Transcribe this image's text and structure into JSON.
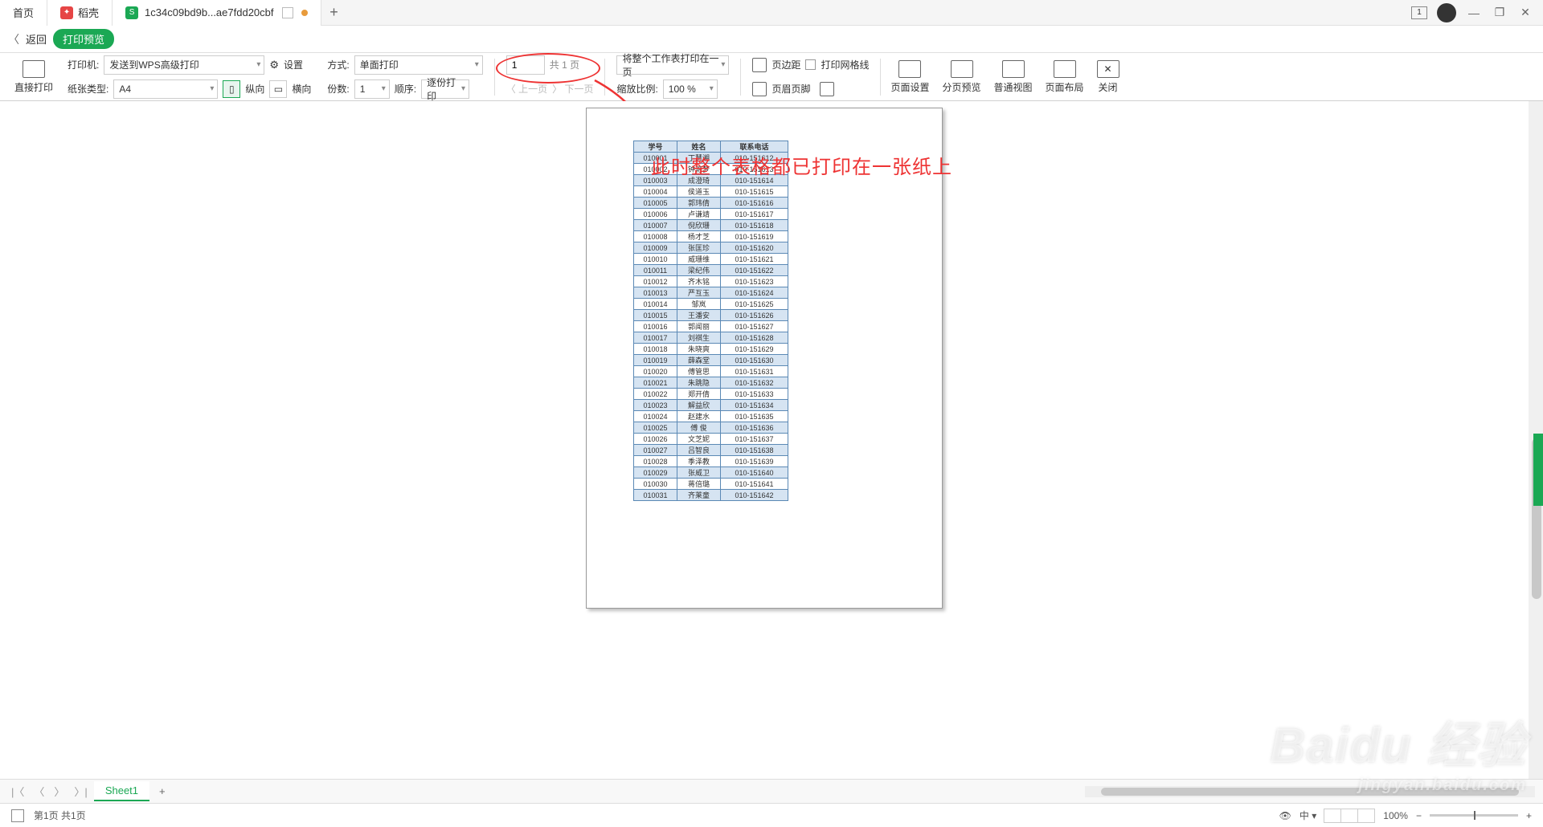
{
  "tabs": {
    "home": "首页",
    "doc": "稻壳",
    "file": "1c34c09bd9b...ae7fdd20cbf",
    "badge": "1"
  },
  "header": {
    "back": "返回",
    "title": "打印预览"
  },
  "toolbar": {
    "direct_print": "直接打印",
    "printer_label": "打印机:",
    "printer_value": "发送到WPS高级打印",
    "paper_label": "纸张类型:",
    "paper_value": "A4",
    "settings": "设置",
    "portrait": "纵向",
    "landscape": "横向",
    "mode_label": "方式:",
    "mode_value": "单面打印",
    "copies_label": "份数:",
    "copies_value": "1",
    "order_label": "顺序:",
    "order_value": "逐份打印",
    "page_current": "1",
    "page_total": "共 1 页",
    "prev_page": "上一页",
    "next_page": "下一页",
    "fit_value": "将整个工作表打印在一页",
    "zoom_label": "缩放比例:",
    "zoom_value": "100 %",
    "margins": "页边距",
    "header_footer": "页眉页脚",
    "print_grid": "打印网格线",
    "page_setup": "页面设置",
    "page_break": "分页预览",
    "normal_view": "普通视图",
    "page_layout": "页面布局",
    "close": "关闭"
  },
  "table": {
    "headers": [
      "学号",
      "姓名",
      "联系电话"
    ],
    "rows": [
      [
        "010001",
        "丁慧湘",
        "010-151612"
      ],
      [
        "010002",
        "钟艳梦",
        "010-151613"
      ],
      [
        "010003",
        "成澄琦",
        "010-151614"
      ],
      [
        "010004",
        "侯道玉",
        "010-151615"
      ],
      [
        "010005",
        "郭玮倩",
        "010-151616"
      ],
      [
        "010006",
        "卢谦靖",
        "010-151617"
      ],
      [
        "010007",
        "倪欣珊",
        "010-151618"
      ],
      [
        "010008",
        "杨才芝",
        "010-151619"
      ],
      [
        "010009",
        "张匡珍",
        "010-151620"
      ],
      [
        "010010",
        "威珊维",
        "010-151621"
      ],
      [
        "010011",
        "梁纪伟",
        "010-151622"
      ],
      [
        "010012",
        "齐木铭",
        "010-151623"
      ],
      [
        "010013",
        "严互玉",
        "010-151624"
      ],
      [
        "010014",
        "邹岚",
        "010-151625"
      ],
      [
        "010015",
        "王潘安",
        "010-151626"
      ],
      [
        "010016",
        "郭闻丽",
        "010-151627"
      ],
      [
        "010017",
        "刘祺生",
        "010-151628"
      ],
      [
        "010018",
        "朱晓爽",
        "010-151629"
      ],
      [
        "010019",
        "薛森堂",
        "010-151630"
      ],
      [
        "010020",
        "傅管思",
        "010-151631"
      ],
      [
        "010021",
        "朱跳隐",
        "010-151632"
      ],
      [
        "010022",
        "郑开倩",
        "010-151633"
      ],
      [
        "010023",
        "解益欣",
        "010-151634"
      ],
      [
        "010024",
        "赵建水",
        "010-151635"
      ],
      [
        "010025",
        "傅 俊",
        "010-151636"
      ],
      [
        "010026",
        "文芝妮",
        "010-151637"
      ],
      [
        "010027",
        "吕智良",
        "010-151638"
      ],
      [
        "010028",
        "季泽教",
        "010-151639"
      ],
      [
        "010029",
        "张威卫",
        "010-151640"
      ],
      [
        "010030",
        "蒋倍璐",
        "010-151641"
      ],
      [
        "010031",
        "齐莱童",
        "010-151642"
      ]
    ]
  },
  "annotation": "此时整个表格都已打印在一张纸上",
  "sheet": {
    "name": "Sheet1"
  },
  "status": {
    "page_info": "第1页 共1页",
    "zoom": "100%"
  },
  "watermark": {
    "main": "Baidu 经验",
    "sub": "jingyan.baidu.com"
  }
}
